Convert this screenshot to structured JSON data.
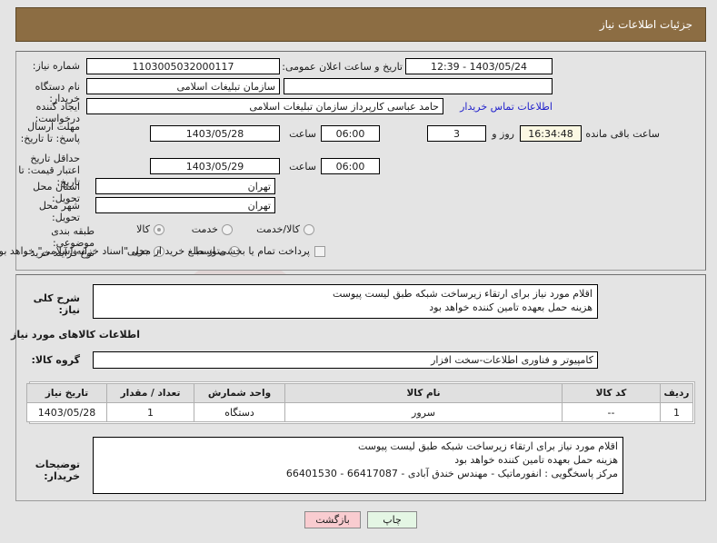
{
  "header": {
    "title": "جزئیات اطلاعات نیاز"
  },
  "form": {
    "need_number_label": "شماره نیاز:",
    "need_number_value": "1103005032000117",
    "announce_label": "تاریخ و ساعت اعلان عمومی:",
    "announce_value": "1403/05/24 - 12:39",
    "buyer_org_label": "نام دستگاه خریدار:",
    "buyer_org_value": "سازمان تبلیغات اسلامی",
    "creator_label": "ایجاد کننده درخواست:",
    "creator_value": "حامد عباسی کارپرداز سازمان تبلیغات اسلامی",
    "contact_link": "اطلاعات تماس خریدار",
    "deadline_label": "مهلت ارسال پاسخ: تا تاریخ:",
    "deadline_date": "1403/05/28",
    "deadline_hour_label": "ساعت",
    "deadline_hour": "06:00",
    "days_value": "3",
    "days_label": "روز و",
    "countdown_value": "16:34:48",
    "countdown_label": "ساعت باقی مانده",
    "price_valid_label": "حداقل تاریخ اعتبار قیمت: تا تاریخ:",
    "price_valid_date": "1403/05/29",
    "price_valid_hour_label": "ساعت",
    "price_valid_hour": "06:00",
    "province_label": "استان محل تحویل:",
    "province_value": "تهران",
    "city_label": "شهر محل تحویل:",
    "city_value": "تهران",
    "category_label": "طبقه بندی موضوعی:",
    "category_options": [
      {
        "label": "کالا",
        "checked": true
      },
      {
        "label": "خدمت",
        "checked": false
      },
      {
        "label": "کالا/خدمت",
        "checked": false
      }
    ],
    "process_label": "نوع فرآیند خرید :",
    "process_options": [
      {
        "label": "جزیی",
        "checked": true
      },
      {
        "label": "متوسط",
        "checked": false
      }
    ],
    "treasury_checkbox_label": "پرداخت تمام یا بخشی از مبلغ خرید از محل \"اسناد خزانه اسلامی\" خواهد بود.",
    "treasury_checked": false
  },
  "description": {
    "label": "شرح کلی نیاز:",
    "value": "اقلام مورد نیاز برای ارتقاء زیرساخت شبکه طبق لیست پیوست\nهزینه حمل بعهده تامین کننده خواهد بود"
  },
  "goods_section": {
    "heading": "اطلاعات کالاهای مورد نیاز",
    "group_label": "گروه کالا:",
    "group_value": "کامپیوتر و فناوری اطلاعات-سخت افزار"
  },
  "table": {
    "columns": [
      "ردیف",
      "کد کالا",
      "نام کالا",
      "واحد شمارش",
      "تعداد / مقدار",
      "تاریخ نیاز"
    ],
    "rows": [
      {
        "row": "1",
        "code": "--",
        "name": "سرور",
        "unit": "دستگاه",
        "qty": "1",
        "need_date": "1403/05/28"
      }
    ]
  },
  "buyer_notes": {
    "label": "توضیحات خریدار:",
    "value": "اقلام مورد نیاز برای ارتقاء زیرساخت شبکه طبق لیست پیوست\nهزینه حمل بعهده تامین کننده خواهد بود\nمرکز پاسخگویی : انفورماتیک - مهندس خندق آبادی - 66417087 - 66401530"
  },
  "buttons": {
    "back": "بازگشت",
    "print": "چاپ"
  },
  "colors": {
    "header_bg": "#8c6d43",
    "page_bg": "#e4e4e4",
    "link": "#2222cc",
    "back_btn": "#f9ccd0",
    "print_btn": "#e4f6e4",
    "table_header": "#e0e0e0",
    "countdown_bg": "#fbf8e3"
  }
}
